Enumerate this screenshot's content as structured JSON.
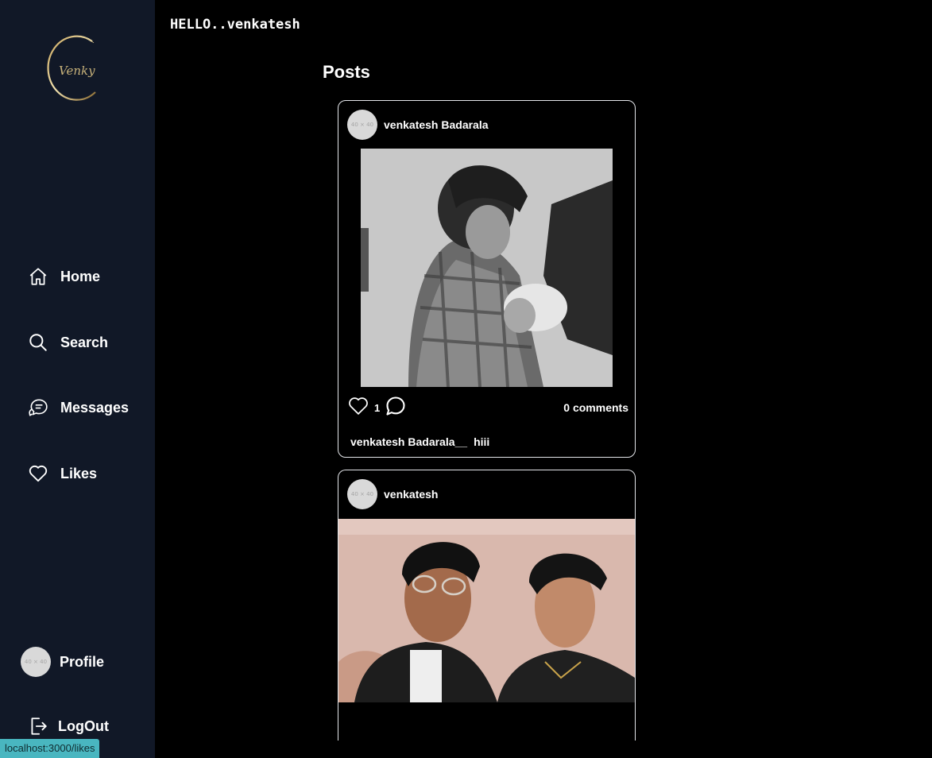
{
  "sidebar": {
    "logo_text": "Venky",
    "items": [
      {
        "label": "Home",
        "icon": "home-icon"
      },
      {
        "label": "Search",
        "icon": "search-icon"
      },
      {
        "label": "Messages",
        "icon": "messages-icon"
      },
      {
        "label": "Likes",
        "icon": "heart-icon"
      }
    ],
    "profile": {
      "label": "Profile",
      "avatar_text": "40 × 40"
    },
    "logout": {
      "label": "LogOut",
      "icon": "logout-icon"
    }
  },
  "status_bar": {
    "url": "localhost:3000/likes"
  },
  "header": {
    "greeting": "HELLO..venkatesh"
  },
  "feed": {
    "heading": "Posts",
    "posts": [
      {
        "username": "venkatesh Badarala",
        "avatar_text": "40 × 40",
        "likes": "1",
        "comments": "0 comments",
        "caption_user": "venkatesh Badarala__",
        "caption_text": "hiii"
      },
      {
        "username": "venkatesh",
        "avatar_text": "40 × 40"
      }
    ]
  },
  "colors": {
    "sidebar_bg": "#111827",
    "page_bg": "#000000",
    "card_border": "#e5e7eb",
    "status_bg": "#49b6c0"
  }
}
